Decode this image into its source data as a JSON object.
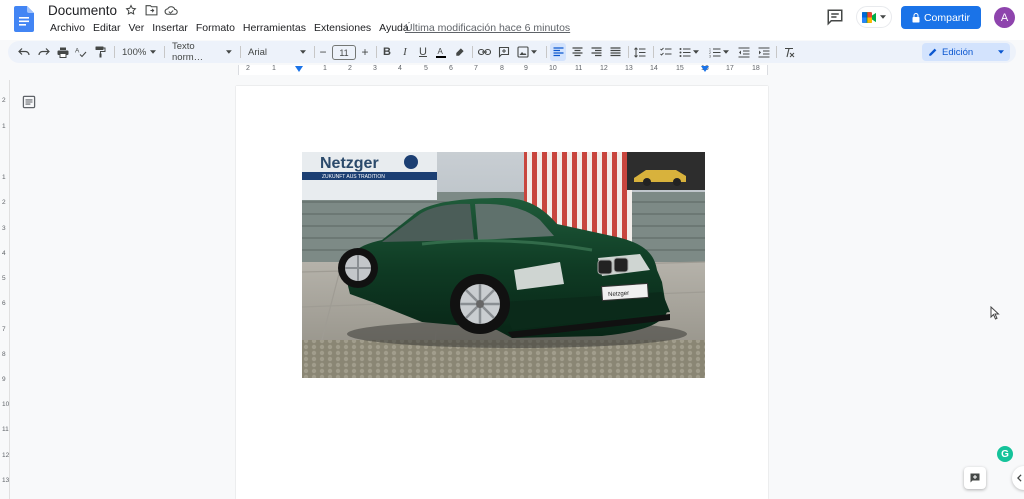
{
  "header": {
    "title": "Documento",
    "menu": [
      "Archivo",
      "Editar",
      "Ver",
      "Insertar",
      "Formato",
      "Herramientas",
      "Extensiones",
      "Ayuda"
    ],
    "last_edit": "Última modificación hace 6 minutos",
    "share_label": "Compartir",
    "avatar_initial": "A"
  },
  "toolbar": {
    "zoom": "100%",
    "style": "Texto norm…",
    "font": "Arial",
    "font_size": "11",
    "mode": "Edición"
  },
  "ruler": {
    "numbers": [
      "2",
      "1",
      "1",
      "2",
      "3",
      "4",
      "5",
      "6",
      "7",
      "8",
      "9",
      "10",
      "11",
      "12",
      "13",
      "14",
      "15",
      "16",
      "17",
      "18"
    ],
    "vertical_numbers": [
      "2",
      "1",
      "1",
      "2",
      "3",
      "4",
      "5",
      "6",
      "7",
      "8",
      "9",
      "10",
      "11",
      "12",
      "13"
    ]
  },
  "image": {
    "sign_text": "Netzger",
    "sign_sub": "ZUKUNFT AUS TRADITION",
    "plate": "Netzger"
  },
  "colors": {
    "accent": "#1a73e8",
    "car": "#0f3b24",
    "avatar": "#8e44ad"
  },
  "widgets": {
    "grammarly": "G"
  }
}
